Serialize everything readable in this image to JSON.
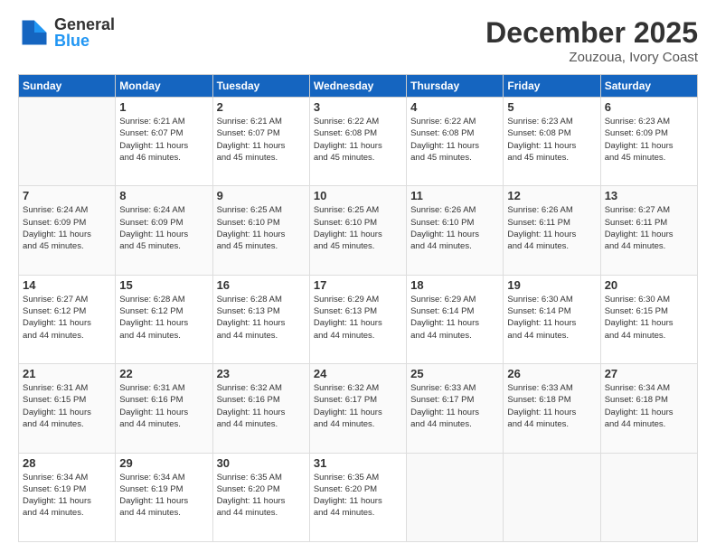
{
  "logo": {
    "general": "General",
    "blue": "Blue"
  },
  "title": "December 2025",
  "subtitle": "Zouzoua, Ivory Coast",
  "days": [
    "Sunday",
    "Monday",
    "Tuesday",
    "Wednesday",
    "Thursday",
    "Friday",
    "Saturday"
  ],
  "weeks": [
    [
      {
        "day": "",
        "info": ""
      },
      {
        "day": "1",
        "info": "Sunrise: 6:21 AM\nSunset: 6:07 PM\nDaylight: 11 hours\nand 46 minutes."
      },
      {
        "day": "2",
        "info": "Sunrise: 6:21 AM\nSunset: 6:07 PM\nDaylight: 11 hours\nand 45 minutes."
      },
      {
        "day": "3",
        "info": "Sunrise: 6:22 AM\nSunset: 6:08 PM\nDaylight: 11 hours\nand 45 minutes."
      },
      {
        "day": "4",
        "info": "Sunrise: 6:22 AM\nSunset: 6:08 PM\nDaylight: 11 hours\nand 45 minutes."
      },
      {
        "day": "5",
        "info": "Sunrise: 6:23 AM\nSunset: 6:08 PM\nDaylight: 11 hours\nand 45 minutes."
      },
      {
        "day": "6",
        "info": "Sunrise: 6:23 AM\nSunset: 6:09 PM\nDaylight: 11 hours\nand 45 minutes."
      }
    ],
    [
      {
        "day": "7",
        "info": "Sunrise: 6:24 AM\nSunset: 6:09 PM\nDaylight: 11 hours\nand 45 minutes."
      },
      {
        "day": "8",
        "info": "Sunrise: 6:24 AM\nSunset: 6:09 PM\nDaylight: 11 hours\nand 45 minutes."
      },
      {
        "day": "9",
        "info": "Sunrise: 6:25 AM\nSunset: 6:10 PM\nDaylight: 11 hours\nand 45 minutes."
      },
      {
        "day": "10",
        "info": "Sunrise: 6:25 AM\nSunset: 6:10 PM\nDaylight: 11 hours\nand 45 minutes."
      },
      {
        "day": "11",
        "info": "Sunrise: 6:26 AM\nSunset: 6:10 PM\nDaylight: 11 hours\nand 44 minutes."
      },
      {
        "day": "12",
        "info": "Sunrise: 6:26 AM\nSunset: 6:11 PM\nDaylight: 11 hours\nand 44 minutes."
      },
      {
        "day": "13",
        "info": "Sunrise: 6:27 AM\nSunset: 6:11 PM\nDaylight: 11 hours\nand 44 minutes."
      }
    ],
    [
      {
        "day": "14",
        "info": "Sunrise: 6:27 AM\nSunset: 6:12 PM\nDaylight: 11 hours\nand 44 minutes."
      },
      {
        "day": "15",
        "info": "Sunrise: 6:28 AM\nSunset: 6:12 PM\nDaylight: 11 hours\nand 44 minutes."
      },
      {
        "day": "16",
        "info": "Sunrise: 6:28 AM\nSunset: 6:13 PM\nDaylight: 11 hours\nand 44 minutes."
      },
      {
        "day": "17",
        "info": "Sunrise: 6:29 AM\nSunset: 6:13 PM\nDaylight: 11 hours\nand 44 minutes."
      },
      {
        "day": "18",
        "info": "Sunrise: 6:29 AM\nSunset: 6:14 PM\nDaylight: 11 hours\nand 44 minutes."
      },
      {
        "day": "19",
        "info": "Sunrise: 6:30 AM\nSunset: 6:14 PM\nDaylight: 11 hours\nand 44 minutes."
      },
      {
        "day": "20",
        "info": "Sunrise: 6:30 AM\nSunset: 6:15 PM\nDaylight: 11 hours\nand 44 minutes."
      }
    ],
    [
      {
        "day": "21",
        "info": "Sunrise: 6:31 AM\nSunset: 6:15 PM\nDaylight: 11 hours\nand 44 minutes."
      },
      {
        "day": "22",
        "info": "Sunrise: 6:31 AM\nSunset: 6:16 PM\nDaylight: 11 hours\nand 44 minutes."
      },
      {
        "day": "23",
        "info": "Sunrise: 6:32 AM\nSunset: 6:16 PM\nDaylight: 11 hours\nand 44 minutes."
      },
      {
        "day": "24",
        "info": "Sunrise: 6:32 AM\nSunset: 6:17 PM\nDaylight: 11 hours\nand 44 minutes."
      },
      {
        "day": "25",
        "info": "Sunrise: 6:33 AM\nSunset: 6:17 PM\nDaylight: 11 hours\nand 44 minutes."
      },
      {
        "day": "26",
        "info": "Sunrise: 6:33 AM\nSunset: 6:18 PM\nDaylight: 11 hours\nand 44 minutes."
      },
      {
        "day": "27",
        "info": "Sunrise: 6:34 AM\nSunset: 6:18 PM\nDaylight: 11 hours\nand 44 minutes."
      }
    ],
    [
      {
        "day": "28",
        "info": "Sunrise: 6:34 AM\nSunset: 6:19 PM\nDaylight: 11 hours\nand 44 minutes."
      },
      {
        "day": "29",
        "info": "Sunrise: 6:34 AM\nSunset: 6:19 PM\nDaylight: 11 hours\nand 44 minutes."
      },
      {
        "day": "30",
        "info": "Sunrise: 6:35 AM\nSunset: 6:20 PM\nDaylight: 11 hours\nand 44 minutes."
      },
      {
        "day": "31",
        "info": "Sunrise: 6:35 AM\nSunset: 6:20 PM\nDaylight: 11 hours\nand 44 minutes."
      },
      {
        "day": "",
        "info": ""
      },
      {
        "day": "",
        "info": ""
      },
      {
        "day": "",
        "info": ""
      }
    ]
  ]
}
